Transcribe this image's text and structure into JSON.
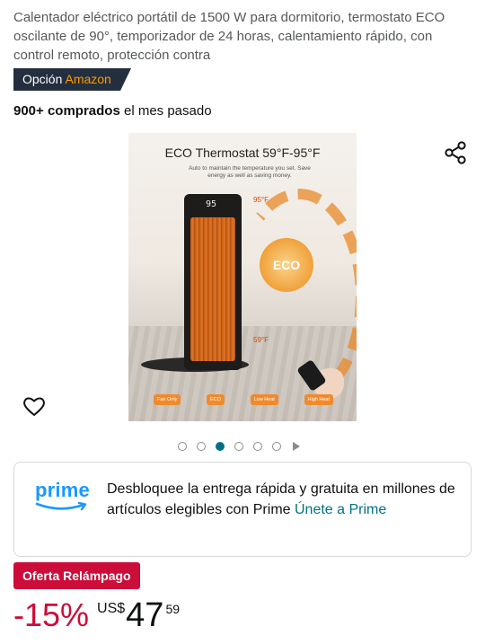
{
  "product": {
    "title": "Calentador eléctrico portátil de 1500 W para dormitorio, termostato ECO oscilante de 90°, temporizador de 24 horas, calentamiento rápido, con control remoto, protección contra"
  },
  "choice_badge": {
    "prefix": "Opción",
    "brand": "Amazon"
  },
  "social_proof": {
    "count": "900+ comprados",
    "suffix": " el mes pasado"
  },
  "icons": {
    "share": "share-icon",
    "wishlist": "heart-icon"
  },
  "image": {
    "headline": "ECO Thermostat 59°F-95°F",
    "subline": "Auto to maintain the temperature you set. Save energy as well as saving money.",
    "display_value": "95",
    "eco_label": "ECO",
    "temp_high": "95°F",
    "temp_low": "59°F",
    "modes": [
      "Fan Only",
      "ECO",
      "Low Heat",
      "High Heat"
    ]
  },
  "carousel": {
    "total": 6,
    "active_index": 2
  },
  "prime": {
    "logo_text": "prime",
    "message": "Desbloquee la entrega rápida y gratuita en millones de artículos elegibles con Prime",
    "join_label": "Únete a Prime"
  },
  "deal": {
    "label": "Oferta Relámpago"
  },
  "price": {
    "discount": "-15%",
    "currency": "US$",
    "whole": "47",
    "fraction": "59"
  },
  "colors": {
    "prime_blue": "#1a98ff",
    "deal_red": "#cc0c39",
    "link_teal": "#007185",
    "badge_dark": "#232f3e",
    "amazon_orange": "#ff9900"
  }
}
